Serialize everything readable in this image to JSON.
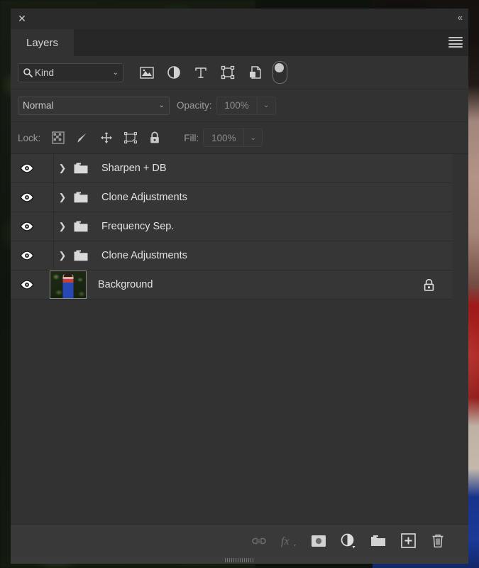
{
  "window": {
    "close_label": "✕",
    "collapse_label": "«",
    "menu_icon": "hamburger-menu-icon"
  },
  "tabs": [
    {
      "label": "Layers",
      "active": true
    }
  ],
  "filter_bar": {
    "kind_label": "Kind",
    "search_icon": "search-icon",
    "chevron": "⌄",
    "filter_icons": [
      {
        "name": "filter-pixel-layers",
        "icon": "image-icon"
      },
      {
        "name": "filter-adjustment-layers",
        "icon": "adjustment-half-circle-icon"
      },
      {
        "name": "filter-type-layers",
        "icon": "type-t-icon"
      },
      {
        "name": "filter-shape-layers",
        "icon": "shape-bounding-box-icon"
      },
      {
        "name": "filter-smart-objects",
        "icon": "smart-object-icon"
      }
    ],
    "toggle_name": "filter-enable-toggle",
    "toggle_state": "off"
  },
  "blend_bar": {
    "blend_mode": "Normal",
    "blend_chevron": "⌄",
    "opacity_label": "Opacity:",
    "opacity_value": "100%",
    "opacity_chevron": "⌄"
  },
  "lock_bar": {
    "label": "Lock:",
    "icons": [
      {
        "name": "lock-transparent-pixels-icon",
        "icon": "checkerboard-icon"
      },
      {
        "name": "lock-image-pixels-icon",
        "icon": "brush-icon"
      },
      {
        "name": "lock-position-icon",
        "icon": "move-arrows-icon"
      },
      {
        "name": "lock-artboard-nesting-icon",
        "icon": "artboard-icon"
      },
      {
        "name": "lock-all-icon",
        "icon": "padlock-icon"
      }
    ],
    "fill_label": "Fill:",
    "fill_value": "100%",
    "fill_chevron": "⌄"
  },
  "layers": [
    {
      "name": "Sharpen + DB",
      "type": "group",
      "visible": true,
      "expanded": false,
      "locked": false,
      "chevron": "❯"
    },
    {
      "name": "Clone Adjustments",
      "type": "group",
      "visible": true,
      "expanded": false,
      "locked": false,
      "chevron": "❯"
    },
    {
      "name": "Frequency Sep.",
      "type": "group",
      "visible": true,
      "expanded": false,
      "locked": false,
      "chevron": "❯"
    },
    {
      "name": "Clone Adjustments",
      "type": "group",
      "visible": true,
      "expanded": false,
      "locked": false,
      "chevron": "❯"
    },
    {
      "name": "Background",
      "type": "image",
      "visible": true,
      "expanded": false,
      "locked": true,
      "chevron": ""
    }
  ],
  "footer": {
    "buttons": [
      {
        "name": "link-layers-button",
        "icon": "link-icon",
        "enabled": false
      },
      {
        "name": "layer-style-button",
        "icon": "fx-icon",
        "enabled": false
      },
      {
        "name": "add-layer-mask-button",
        "icon": "mask-icon",
        "enabled": true
      },
      {
        "name": "adjustment-layer-button",
        "icon": "adjustment-half-circle-icon",
        "enabled": true
      },
      {
        "name": "new-group-button",
        "icon": "folder-icon",
        "enabled": true
      },
      {
        "name": "new-layer-button",
        "icon": "new-layer-plus-icon",
        "enabled": true
      },
      {
        "name": "delete-layer-button",
        "icon": "trash-icon",
        "enabled": true
      }
    ],
    "resize_grip": "panel-resize-grip"
  },
  "colors": {
    "panel_bg": "#323232",
    "row_bg": "#363636",
    "text": "#e2e2e2",
    "muted_text": "#9a9a9a",
    "tab_bg": "#272727",
    "footer_bg": "#393939"
  }
}
